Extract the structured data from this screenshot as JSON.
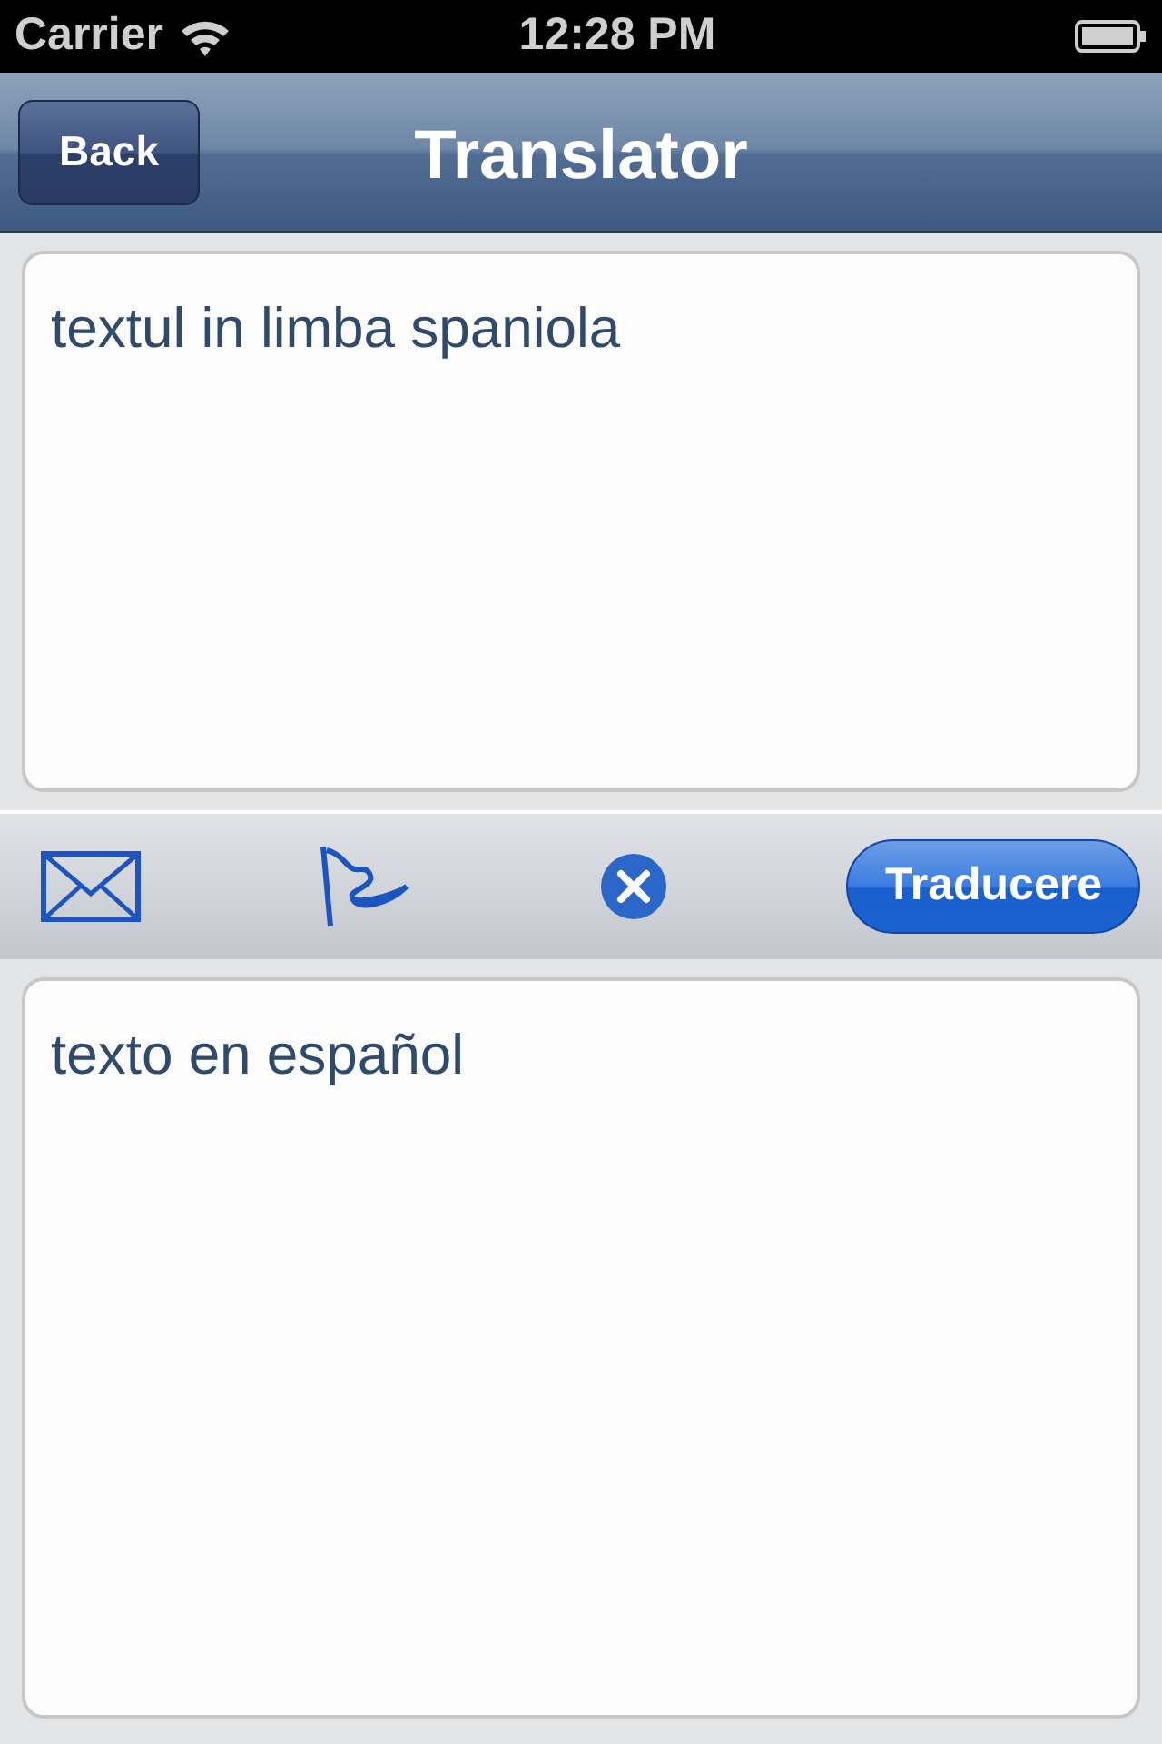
{
  "status_bar": {
    "carrier": "Carrier",
    "time": "12:28 PM"
  },
  "nav_bar": {
    "back": "Back",
    "title": "Translator"
  },
  "source_text": {
    "value": "textul in limba spaniola"
  },
  "toolbar": {
    "translate_button": "Traducere"
  },
  "result_text": {
    "value": "texto en español"
  }
}
